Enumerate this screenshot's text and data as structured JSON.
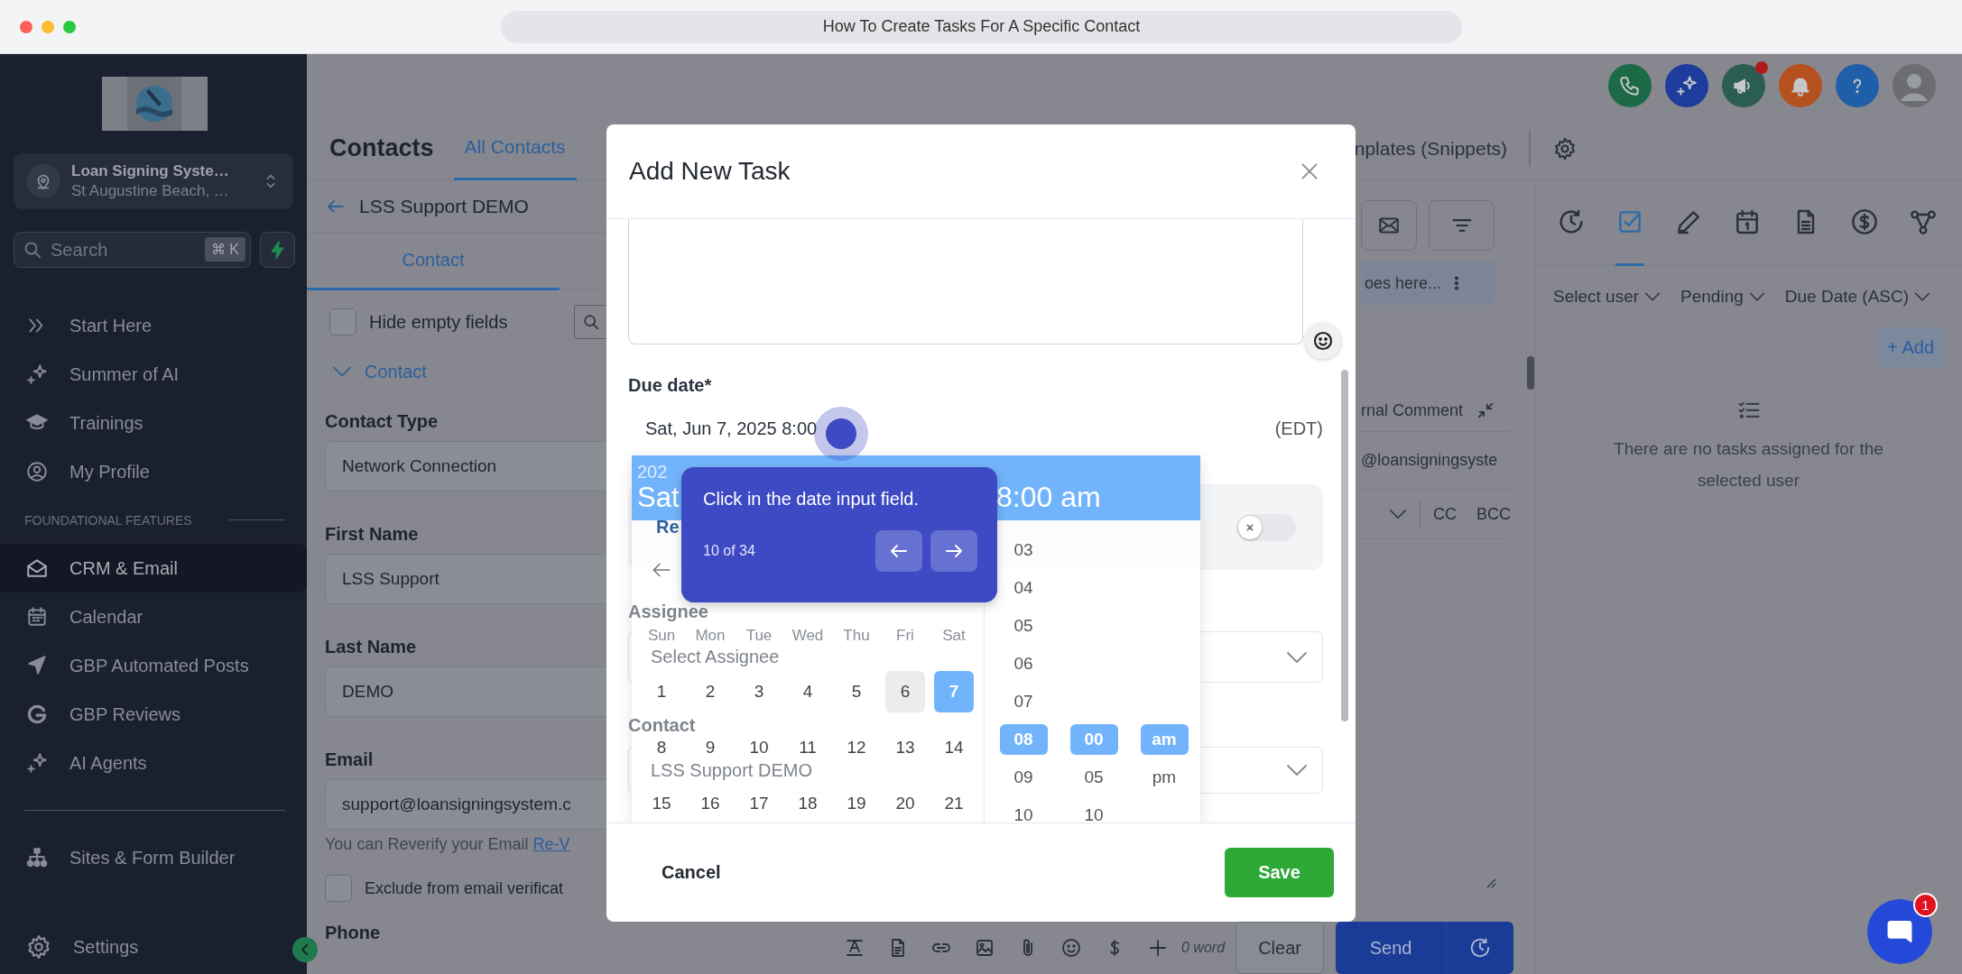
{
  "browser": {
    "title": "How To Create Tasks For A Specific Contact"
  },
  "sidebar": {
    "location": {
      "name": "Loan Signing Syste…",
      "address": "St Augustine Beach, …"
    },
    "search": {
      "placeholder": "Search",
      "shortcut": "⌘ K"
    },
    "groups": [
      {
        "items": [
          {
            "kind": "chevrons",
            "label": "Start Here",
            "selected": false
          },
          {
            "kind": "sparkle",
            "label": "Summer of AI",
            "selected": false
          },
          {
            "kind": "cap",
            "label": "Trainings",
            "selected": false
          },
          {
            "kind": "user",
            "label": "My Profile",
            "selected": false
          }
        ]
      },
      {
        "heading": "FOUNDATIONAL FEATURES",
        "items": [
          {
            "kind": "mail",
            "label": "CRM & Email",
            "selected": true
          },
          {
            "kind": "calendar",
            "label": "Calendar",
            "selected": false
          },
          {
            "kind": "nav",
            "label": "GBP Automated Posts",
            "selected": false
          },
          {
            "kind": "g",
            "label": "GBP Reviews",
            "selected": false
          },
          {
            "kind": "sparkle",
            "label": "AI Agents",
            "selected": false
          }
        ]
      },
      {
        "divider": true,
        "items": [
          {
            "kind": "sitemap",
            "label": "Sites & Form Builder",
            "selected": false
          }
        ]
      }
    ],
    "settings": "Settings"
  },
  "top_icons": [
    {
      "kind": "phone"
    },
    {
      "kind": "sparkle"
    },
    {
      "kind": "megaphone",
      "badge": true
    },
    {
      "kind": "bell"
    },
    {
      "kind": "help"
    },
    {
      "kind": "avatar"
    }
  ],
  "header": {
    "title": "Contacts",
    "tabs": [
      {
        "label": "All Contacts",
        "selected": true
      }
    ],
    "snippets": "nplates (Snippets)"
  },
  "contact_panel": {
    "name": "LSS Support DEMO",
    "tabs": [
      {
        "label": "Contact",
        "selected": true
      }
    ],
    "hide_empty": {
      "label": "Hide empty fields",
      "checked": false
    },
    "section": {
      "label": "Contact",
      "expanded": true
    },
    "fields": [
      {
        "label": "Contact Type",
        "value": "Network Connection"
      },
      {
        "label": "First Name",
        "value": "LSS Support"
      },
      {
        "label": "Last Name",
        "value": "DEMO"
      },
      {
        "label": "Email",
        "value": "support@loansigningsystem.c"
      }
    ],
    "email_helper": "You can Reverify your Email",
    "email_link": "Re-V",
    "exclude": {
      "label": "Exclude from email verificat",
      "checked": false
    },
    "phone_label": "Phone"
  },
  "conversation": {
    "message_fragment": "oes here...",
    "comment_tab": "rnal Comment",
    "from_fragment": "@loansigningsyste",
    "cc": "CC",
    "bcc": "BCC",
    "word_count": "0 word",
    "clear": "Clear",
    "send": "Send"
  },
  "tasks_panel": {
    "tabs": [
      {
        "kind": "history",
        "selected": false
      },
      {
        "kind": "task",
        "selected": true
      },
      {
        "kind": "pencil",
        "selected": false
      },
      {
        "kind": "calendar",
        "selected": false
      },
      {
        "kind": "document",
        "selected": false
      },
      {
        "kind": "dollar",
        "selected": false
      },
      {
        "kind": "nodes",
        "selected": false
      }
    ],
    "filters": [
      "Select user",
      "Pending",
      "Due Date (ASC)"
    ],
    "add": "+ Add",
    "empty": "There are no tasks assigned for the selected user"
  },
  "modal": {
    "title": "Add New Task",
    "due_label": "Due date*",
    "due_value": "Sat, Jun 7, 2025 8:00",
    "timezone": "(EDT)",
    "recurring_fragment": "Re",
    "recurring_on": false,
    "assignee_label": "Assignee",
    "assignee_placeholder": "Select Assignee",
    "contact_label": "Contact",
    "contact_value": "LSS Support DEMO",
    "cancel": "Cancel",
    "save": "Save"
  },
  "calendar": {
    "year": "202",
    "day": "Sat",
    "time": "8:00 am",
    "weekdays": [
      "Sun",
      "Mon",
      "Tue",
      "Wed",
      "Thu",
      "Fri",
      "Sat"
    ],
    "weeks": [
      [
        {
          "label": "1",
          "selected": false,
          "today": false
        },
        {
          "label": "2",
          "selected": false,
          "today": false
        },
        {
          "label": "3",
          "selected": false,
          "today": false
        },
        {
          "label": "4",
          "selected": false,
          "today": false
        },
        {
          "label": "5",
          "selected": false,
          "today": false
        },
        {
          "label": "6",
          "selected": false,
          "today": true
        },
        {
          "label": "7",
          "selected": true,
          "today": false
        }
      ],
      [
        {
          "label": "8",
          "selected": false,
          "today": false
        },
        {
          "label": "9",
          "selected": false,
          "today": false
        },
        {
          "label": "10",
          "selected": false,
          "today": false
        },
        {
          "label": "11",
          "selected": false,
          "today": false
        },
        {
          "label": "12",
          "selected": false,
          "today": false
        },
        {
          "label": "13",
          "selected": false,
          "today": false
        },
        {
          "label": "14",
          "selected": false,
          "today": false
        }
      ],
      [
        {
          "label": "15",
          "selected": false,
          "today": false
        },
        {
          "label": "16",
          "selected": false,
          "today": false
        },
        {
          "label": "17",
          "selected": false,
          "today": false
        },
        {
          "label": "18",
          "selected": false,
          "today": false
        },
        {
          "label": "19",
          "selected": false,
          "today": false
        },
        {
          "label": "20",
          "selected": false,
          "today": false
        },
        {
          "label": "21",
          "selected": false,
          "today": false
        }
      ]
    ],
    "hours": [
      {
        "label": "03",
        "selected": false
      },
      {
        "label": "04",
        "selected": false
      },
      {
        "label": "05",
        "selected": false
      },
      {
        "label": "06",
        "selected": false
      },
      {
        "label": "07",
        "selected": false
      },
      {
        "label": "08",
        "selected": true
      },
      {
        "label": "09",
        "selected": false
      },
      {
        "label": "10",
        "selected": false
      }
    ],
    "minutes": [
      {
        "label": "00",
        "selected": true
      },
      {
        "label": "05",
        "selected": false
      },
      {
        "label": "10",
        "selected": false
      }
    ],
    "periods": [
      {
        "label": "am",
        "selected": true
      },
      {
        "label": "pm",
        "selected": false
      }
    ]
  },
  "tour": {
    "text": "Click in the date input field.",
    "step": "10 of 34"
  },
  "chat": {
    "badge": "1"
  }
}
